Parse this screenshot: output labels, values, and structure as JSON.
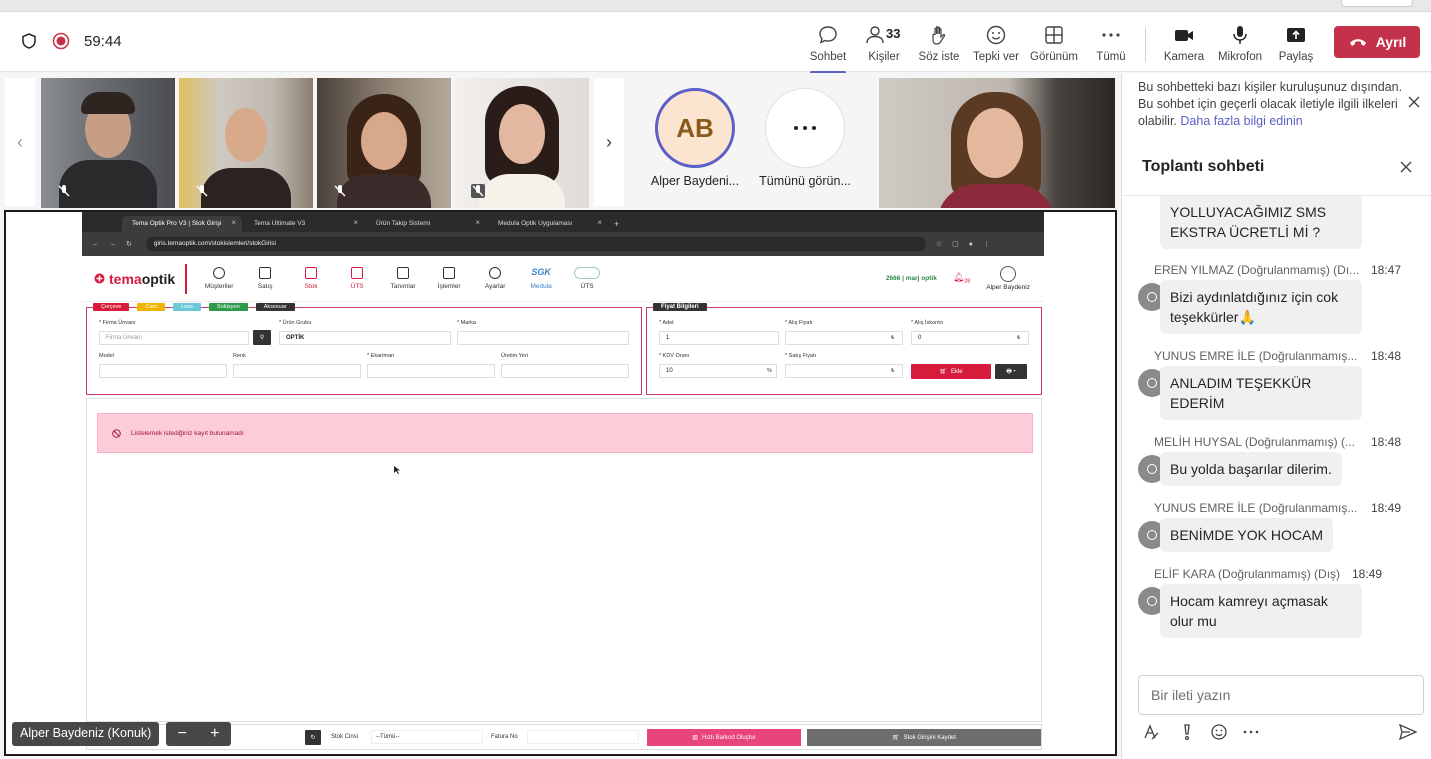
{
  "meeting": {
    "timer": "59:44",
    "people_count": "33",
    "toolbar": [
      {
        "label": "Sohbet",
        "icon": "chat-icon"
      },
      {
        "label": "Kişiler",
        "icon": "people-icon"
      },
      {
        "label": "Söz iste",
        "icon": "raise-hand-icon"
      },
      {
        "label": "Tepki ver",
        "icon": "reaction-icon"
      },
      {
        "label": "Görünüm",
        "icon": "view-grid-icon"
      },
      {
        "label": "Tümü",
        "icon": "more-icon"
      },
      {
        "label": "Kamera",
        "icon": "camera-icon"
      },
      {
        "label": "Mikrofon",
        "icon": "microphone-icon"
      },
      {
        "label": "Paylaş",
        "icon": "share-icon"
      }
    ],
    "leave_label": "Ayrıl"
  },
  "participants": {
    "avatar_initials": "AB",
    "avatar_name": "Alper Baydeni...",
    "see_all_name": "Tümünü görün..."
  },
  "share": {
    "presenter": "Alper Baydeniz (Konuk)",
    "browser": {
      "tabs": [
        "Tema Optik Pro V3 | Stok Girişi",
        "Tema Ultimate V3",
        "Ürün Takip Sistemi",
        "Medula Optik Uygulaması"
      ],
      "url": "giris.temaoptik.com/stokislemleri/stokGirisi"
    },
    "app": {
      "logo_a": "tema",
      "logo_b": "optik",
      "menu": [
        "Müşteriler",
        "Satış",
        "Stok",
        "ÜTS",
        "Tanımlar",
        "İşlemler",
        "Ayarlar",
        "Medula",
        "ÜTS"
      ],
      "sgk": "SGK",
      "user_info": "2666 | marj optik",
      "notif_count": "28",
      "user_name": "Alper Baydeniz",
      "chips": [
        "Çerçeve",
        "Cam",
        "Lens",
        "Solüsyon",
        "Aksesuar"
      ],
      "form": {
        "firma_label": "* Firma Ünvanı",
        "firma_placeholder": "Firma Ünvanı",
        "grup_label": "* Ürün Grubu",
        "grup_value": "OPTİK",
        "marka_label": "* Marka",
        "model_label": "Model",
        "renk_label": "Renk",
        "ekartman_label": "* Ekartman",
        "uretim_label": "Üretim Yeri"
      },
      "price": {
        "title": "Fiyat Bilgileri",
        "adet_label": "* Adet",
        "adet_value": "1",
        "alis_label": "* Alış Fiyatı",
        "iskonto_label": "* Alış İskonto",
        "iskonto_value": "0",
        "kdv_label": "* KDV Oranı",
        "kdv_value": "10",
        "satis_label": "* Satış Fiyatı",
        "ekle_label": "Ekle",
        "currency": "₺",
        "percent": "%"
      },
      "alert": "Listelemek istediğiniz kayıt bulunamadı",
      "bottom": {
        "stok_cinsi_label": "Stok Cinsi",
        "stok_cinsi_value": "--Tümü--",
        "fatura_label": "Fatura No",
        "barkod_label": "Hızlı Barkod Oluştur",
        "kaydet_label": "Stok Girişini Kaydet"
      }
    }
  },
  "side": {
    "notice": "Bu sohbetteki bazı kişiler kuruluşunuz dışından. Bu sohbet için geçerli olacak iletiyle ilgili ilkeleri olabilir.",
    "notice_link": "Daha fazla bilgi edinin",
    "chat_title": "Toplantı sohbeti",
    "messages": [
      {
        "sender": "",
        "time": "",
        "text": "YOLLUYACAĞIMIZ SMS EKSTRA ÜCRETLİ Mİ ?"
      },
      {
        "sender": "EREN YILMAZ (Doğrulanmamış) (Dı...",
        "time": "18:47",
        "text": "Bizi aydınlatdığınız için cok teşekkürler🙏"
      },
      {
        "sender": "YUNUS EMRE İLE (Doğrulanmamış...",
        "time": "18:48",
        "text": "ANLADIM TEŞEKKÜR EDERİM"
      },
      {
        "sender": "MELİH HUYSAL (Doğrulanmamış) (...",
        "time": "18:48",
        "text": "Bu yolda başarılar dilerim."
      },
      {
        "sender": "YUNUS EMRE İLE (Doğrulanmamış...",
        "time": "18:49",
        "text": "BENİMDE YOK HOCAM"
      },
      {
        "sender": "ELİF KARA (Doğrulanmamış) (Dış)",
        "time": "18:49",
        "text": "Hocam kamreyı açmasak olur mu"
      }
    ],
    "compose_placeholder": "Bir ileti yazın"
  }
}
